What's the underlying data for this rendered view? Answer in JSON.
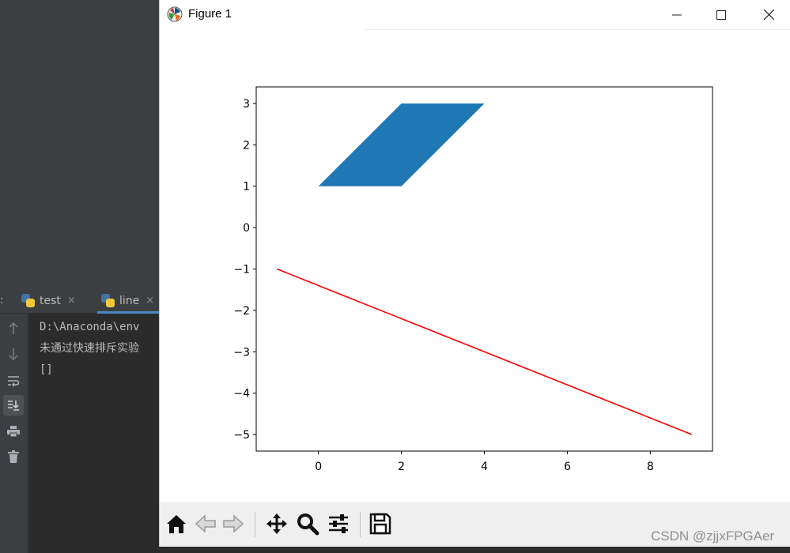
{
  "ide": {
    "tabs": [
      {
        "label": "test",
        "close": "×"
      },
      {
        "label": "line",
        "close": "×"
      }
    ],
    "console_lines": [
      "D:\\Anaconda\\env",
      "未通过快速排斥实验",
      "[]"
    ],
    "gutter_icons": [
      "arrow-up-icon",
      "arrow-down-icon",
      "soft-wrap-icon",
      "scroll-to-end-icon",
      "print-icon",
      "trash-icon"
    ]
  },
  "window": {
    "title": "Figure 1",
    "controls": [
      "minimize",
      "maximize",
      "close"
    ]
  },
  "chart_data": {
    "type": "line",
    "title": "",
    "xlabel": "",
    "ylabel": "",
    "xlim": [
      -1.5,
      9.5
    ],
    "ylim": [
      -5.4,
      3.4
    ],
    "xticks": [
      0,
      2,
      4,
      6,
      8
    ],
    "yticks": [
      3,
      2,
      1,
      0,
      -1,
      -2,
      -3,
      -4,
      -5
    ],
    "xtick_labels": [
      "0",
      "2",
      "4",
      "6",
      "8"
    ],
    "ytick_labels": [
      "3",
      "2",
      "1",
      "0",
      "−1",
      "−2",
      "−3",
      "−4",
      "−5"
    ],
    "polygon": {
      "points": [
        [
          0,
          1
        ],
        [
          2,
          1
        ],
        [
          4,
          3
        ],
        [
          2,
          3
        ]
      ],
      "color": "#1f77b4"
    },
    "series": [
      {
        "x": [
          -1,
          9
        ],
        "y": [
          -1,
          -5
        ],
        "color": "#ff0000"
      }
    ],
    "grid": false
  },
  "toolbar": {
    "buttons": [
      "home-icon",
      "back-icon",
      "forward-icon",
      "pan-icon",
      "zoom-icon",
      "configure-subplots-icon",
      "save-icon"
    ]
  },
  "watermark": "CSDN @zjjxFPGAer"
}
